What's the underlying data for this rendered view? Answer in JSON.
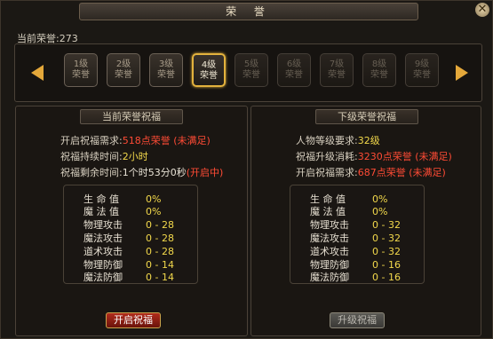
{
  "window": {
    "title": "荣 誉",
    "close_glyph": "✕"
  },
  "current_honor_label": "当前荣誉:273",
  "levels": [
    {
      "l1": "1级",
      "l2": "荣誉"
    },
    {
      "l1": "2级",
      "l2": "荣誉"
    },
    {
      "l1": "3级",
      "l2": "荣誉"
    },
    {
      "l1": "4级",
      "l2": "荣誉"
    },
    {
      "l1": "5级",
      "l2": "荣誉"
    },
    {
      "l1": "6级",
      "l2": "荣誉"
    },
    {
      "l1": "7级",
      "l2": "荣誉"
    },
    {
      "l1": "8级",
      "l2": "荣誉"
    },
    {
      "l1": "9级",
      "l2": "荣誉"
    }
  ],
  "current_panel": {
    "title": "当前荣誉祝福",
    "rows": [
      {
        "label": "开启祝福需求:",
        "value": "518点荣誉 (未满足)"
      },
      {
        "label": "祝福持续时间:",
        "value": "2小时"
      },
      {
        "label": "祝福剩余时间:",
        "value": "1个时53分0秒",
        "extra": "(开启中)"
      }
    ],
    "stats": [
      {
        "label": "生 命 值",
        "value": "0%"
      },
      {
        "label": "魔 法 值",
        "value": "0%"
      },
      {
        "label": "物理攻击",
        "value": "0 - 28"
      },
      {
        "label": "魔法攻击",
        "value": "0 - 28"
      },
      {
        "label": "道术攻击",
        "value": "0 - 28"
      },
      {
        "label": "物理防御",
        "value": "0 - 14"
      },
      {
        "label": "魔法防御",
        "value": "0 - 14"
      }
    ],
    "button": "开启祝福"
  },
  "next_panel": {
    "title": "下级荣誉祝福",
    "rows": [
      {
        "label": "人物等级要求:",
        "value": "32级"
      },
      {
        "label": "祝福升级消耗:",
        "value": "3230点荣誉 (未满足)"
      },
      {
        "label": "开启祝福需求:",
        "value": "687点荣誉 (未满足)"
      }
    ],
    "stats": [
      {
        "label": "生 命 值",
        "value": "0%"
      },
      {
        "label": "魔 法 值",
        "value": "0%"
      },
      {
        "label": "物理攻击",
        "value": "0 - 32"
      },
      {
        "label": "魔法攻击",
        "value": "0 - 32"
      },
      {
        "label": "道术攻击",
        "value": "0 - 32"
      },
      {
        "label": "物理防御",
        "value": "0 - 16"
      },
      {
        "label": "魔法防御",
        "value": "0 - 16"
      }
    ],
    "button": "升级祝福"
  }
}
